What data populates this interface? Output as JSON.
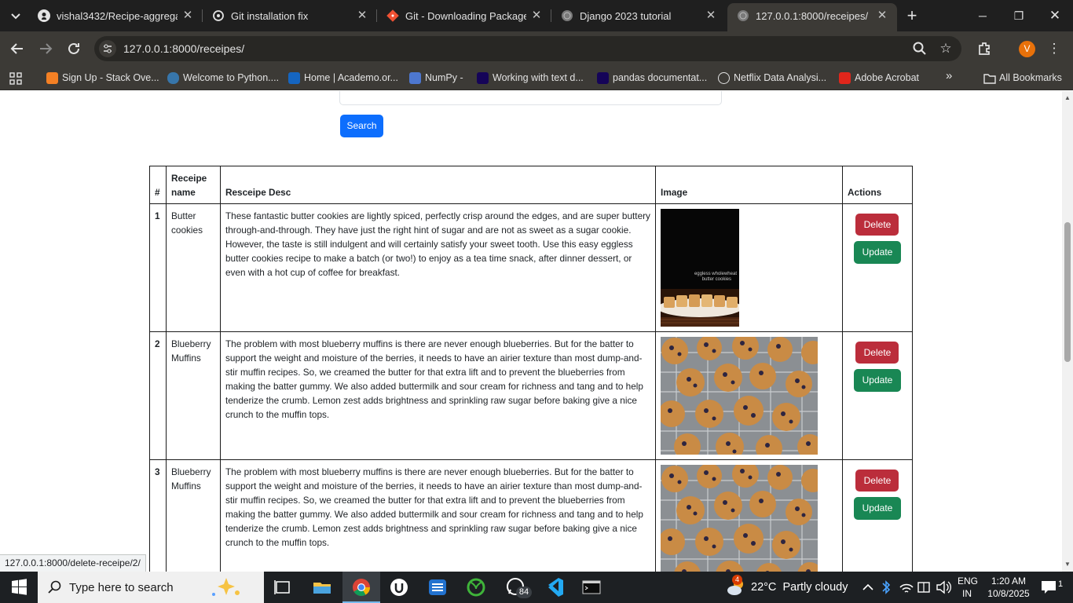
{
  "browser": {
    "tabs": [
      {
        "title": "vishal3432/Recipe-aggregat",
        "favicon": "github-icon",
        "active": false
      },
      {
        "title": "Git installation fix",
        "favicon": "openai-icon",
        "active": false
      },
      {
        "title": "Git - Downloading Package",
        "favicon": "git-icon",
        "active": false
      },
      {
        "title": "Django 2023 tutorial",
        "favicon": "globe-icon",
        "active": false
      },
      {
        "title": "127.0.0.1:8000/receipes/",
        "favicon": "globe-icon",
        "active": true
      }
    ],
    "url": "127.0.0.1:8000/receipes/",
    "profile_initial": "V",
    "bookmarks": [
      {
        "label": "Sign Up - Stack Ove...",
        "color": "#f48024"
      },
      {
        "label": "Welcome to Python....",
        "color": "#3776ab"
      },
      {
        "label": "Home | Academo.or...",
        "color": "#1565c0"
      },
      {
        "label": "NumPy -",
        "color": "#4d77cf"
      },
      {
        "label": "Working with text d...",
        "color": "#150458"
      },
      {
        "label": "pandas documentat...",
        "color": "#150458"
      },
      {
        "label": "Netflix Data Analysi...",
        "color": "#9e9e9e"
      },
      {
        "label": "Adobe Acrobat",
        "color": "#e0261b"
      }
    ],
    "all_bookmarks": "All Bookmarks",
    "status_url": "127.0.0.1:8000/delete-receipe/2/"
  },
  "page": {
    "search_button": "Search",
    "table": {
      "headers": [
        "#",
        "Receipe name",
        "Resceipe Desc",
        "Image",
        "Actions"
      ],
      "rows": [
        {
          "num": "1",
          "name": "Butter cookies",
          "desc": "These fantastic butter cookies are lightly spiced, perfectly crisp around the edges, and are super buttery through-and-through. They have just the right hint of sugar and are not as sweet as a sugar cookie. However, the taste is still indulgent and will certainly satisfy your sweet tooth. Use this easy eggless butter cookies recipe to make a batch (or two!) to enjoy as a tea time snack, after dinner dessert, or even with a hot cup of coffee for breakfast.",
          "image_caption_line1": "eggless wholewheat",
          "image_caption_line2": "butter cookies",
          "delete_label": "Delete",
          "update_label": "Update"
        },
        {
          "num": "2",
          "name": "Blueberry Muffins",
          "desc": "The problem with most blueberry muffins is there are never enough blueberries. But for the batter to support the weight and moisture of the berries, it needs to have an airier texture than most dump-and-stir muffin recipes. So, we creamed the butter for that extra lift and to prevent the blueberries from making the batter gummy. We also added buttermilk and sour cream for richness and tang and to help tenderize the crumb. Lemon zest adds brightness and sprinkling raw sugar before baking give a nice crunch to the muffin tops.",
          "delete_label": "Delete",
          "update_label": "Update"
        },
        {
          "num": "3",
          "name": "Blueberry Muffins",
          "desc": "The problem with most blueberry muffins is there are never enough blueberries. But for the batter to support the weight and moisture of the berries, it needs to have an airier texture than most dump-and-stir muffin recipes. So, we creamed the butter for that extra lift and to prevent the blueberries from making the batter gummy. We also added buttermilk and sour cream for richness and tang and to help tenderize the crumb. Lemon zest adds brightness and sprinkling raw sugar before baking give a nice crunch to the muffin tops.",
          "delete_label": "Delete",
          "update_label": "Update"
        }
      ]
    }
  },
  "taskbar": {
    "search_placeholder": "Type here to search",
    "whatsapp_badge": "84",
    "weather": "22°C  Partly cloudy",
    "weather_badge": "4",
    "language": "ENG",
    "region": "IN",
    "time": "1:20 AM",
    "date": "10/8/2025",
    "notification_count": "1"
  },
  "colors": {
    "primary": "#0d6efd",
    "danger": "#bb2d3b",
    "success": "#198754",
    "chrome_dark": "#1f1f1f",
    "chrome_toolbar": "#3c3a36"
  }
}
